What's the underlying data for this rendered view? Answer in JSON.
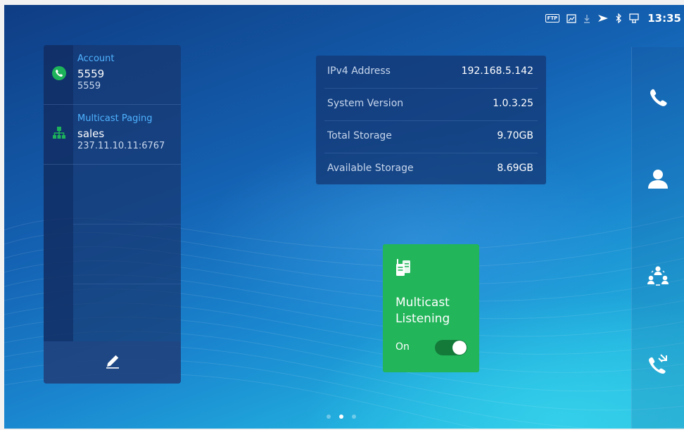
{
  "status_bar": {
    "ftp_label": "FTP",
    "time": "13:35",
    "icons": [
      "ftp-icon",
      "screenshot-icon",
      "download-icon",
      "vpn-shield-icon",
      "bluetooth-icon",
      "network-icon"
    ]
  },
  "accounts_panel": {
    "rows": [
      {
        "title": "Account",
        "main": "5559",
        "sub": "5559",
        "icon": "phone-call-icon",
        "icon_color": "#1db35a"
      },
      {
        "title": "Multicast Paging",
        "main": "sales",
        "sub": "237.11.10.11:6767",
        "icon": "network-tree-icon",
        "icon_color": "#1db35a"
      }
    ],
    "edit_icon": "pencil-icon"
  },
  "info_panel": {
    "rows": [
      {
        "label": "IPv4 Address",
        "value": "192.168.5.142"
      },
      {
        "label": "System Version",
        "value": "1.0.3.25"
      },
      {
        "label": "Total Storage",
        "value": "9.70GB"
      },
      {
        "label": "Available Storage",
        "value": "8.69GB"
      }
    ]
  },
  "multicast_widget": {
    "title": "Multicast Listening",
    "state_label": "On",
    "enabled": true,
    "background": "#23b55a",
    "icon": "walkie-talkie-icon"
  },
  "dock": {
    "items": [
      "phone-icon",
      "contacts-icon",
      "conference-icon",
      "call-history-icon"
    ]
  },
  "pager": {
    "page_count": 3,
    "active_page": 2
  },
  "colors": {
    "accent_blue": "#4fb3ff",
    "green": "#23b55a"
  }
}
